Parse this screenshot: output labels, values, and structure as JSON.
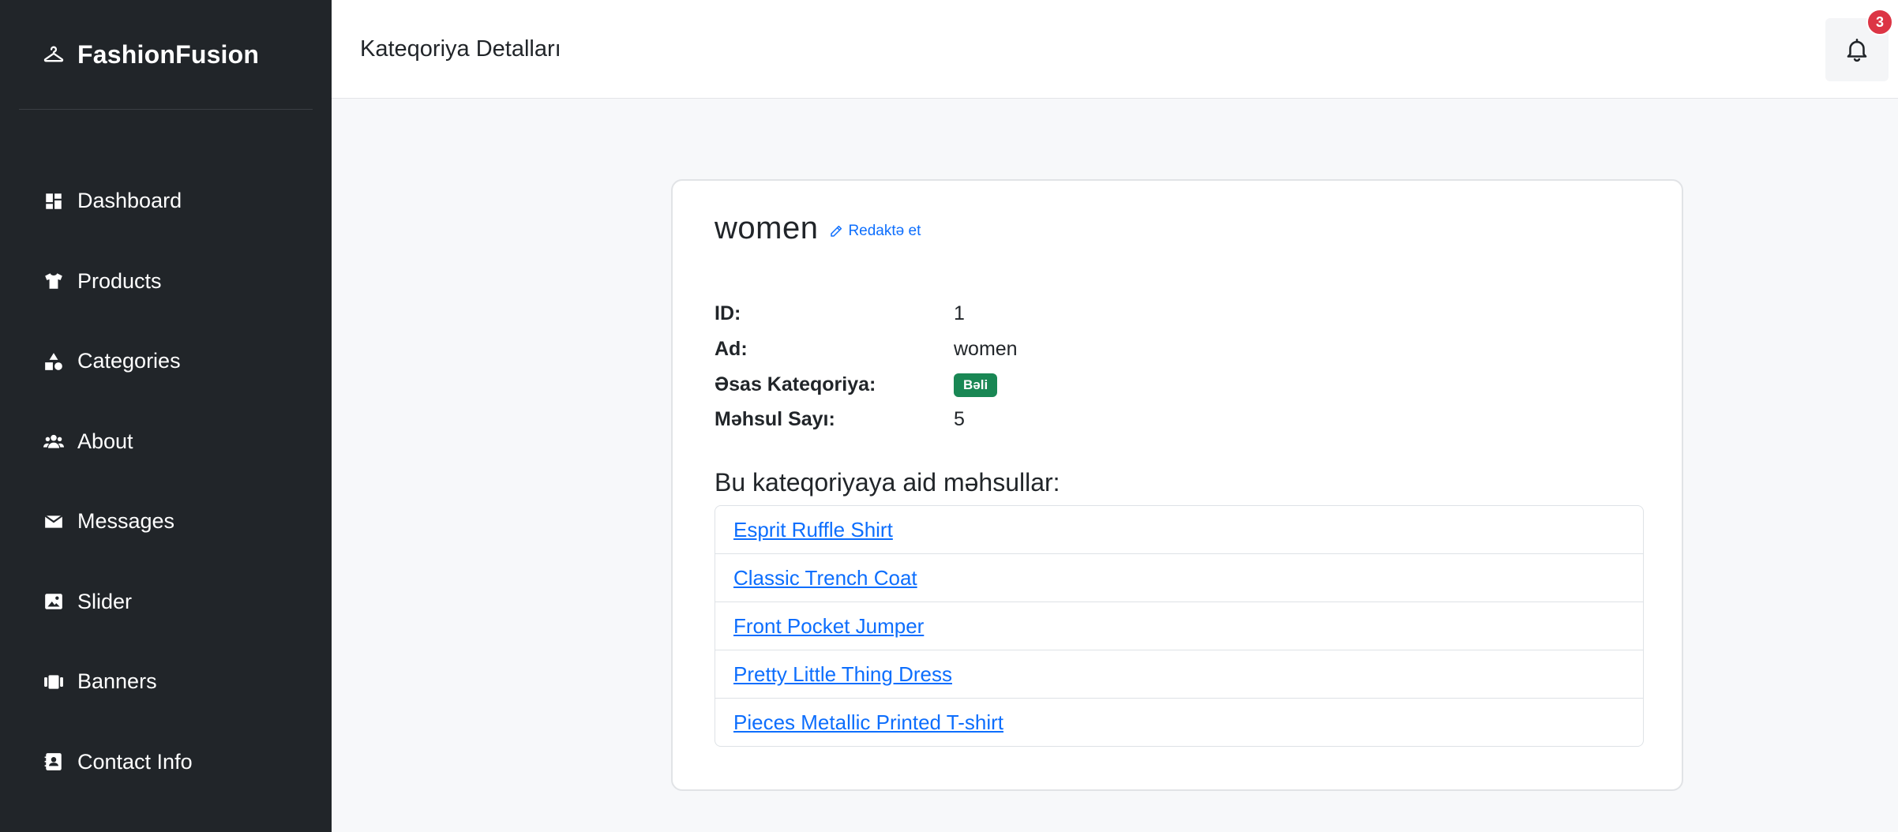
{
  "brand": {
    "name": "FashionFusion",
    "icon": "hanger-icon"
  },
  "sidebar": {
    "items": [
      {
        "label": "Dashboard",
        "icon": "dashboard-icon"
      },
      {
        "label": "Products",
        "icon": "shirt-icon"
      },
      {
        "label": "Categories",
        "icon": "shapes-icon"
      },
      {
        "label": "About",
        "icon": "users-icon"
      },
      {
        "label": "Messages",
        "icon": "envelope-icon"
      },
      {
        "label": "Slider",
        "icon": "image-icon"
      },
      {
        "label": "Banners",
        "icon": "banners-icon"
      },
      {
        "label": "Contact Info",
        "icon": "contact-card-icon"
      }
    ]
  },
  "header": {
    "title": "Kateqoriya Detalları",
    "notifications": {
      "count": "3",
      "icon": "bell-icon"
    }
  },
  "category": {
    "name": "women",
    "edit_label": "Redaktə et",
    "fields": {
      "id_label": "ID:",
      "id_value": "1",
      "name_label": "Ad:",
      "name_value": "women",
      "main_label": "Əsas Kateqoriya:",
      "main_value": "Bəli",
      "count_label": "Məhsul Sayı:",
      "count_value": "5"
    },
    "products_title": "Bu kateqoriyaya aid məhsullar:",
    "products": [
      "Esprit Ruffle Shirt",
      "Classic Trench Coat",
      "Front Pocket Jumper",
      "Pretty Little Thing Dress",
      "Pieces Metallic Printed T-shirt"
    ]
  },
  "colors": {
    "sidebar_bg": "#212529",
    "link": "#0d6efd",
    "success_badge": "#198754",
    "notification_badge": "#dc3545"
  }
}
